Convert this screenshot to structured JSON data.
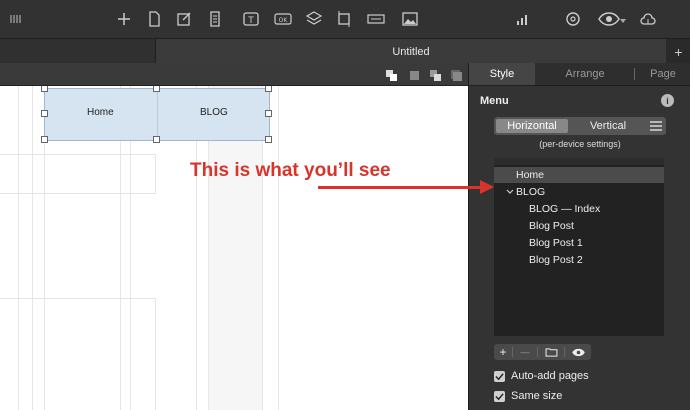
{
  "window": {
    "tab_title": "Untitled",
    "new_tab_label": "+"
  },
  "toolbar": {
    "icons": [
      "grip-icon",
      "plus-icon",
      "page-icon",
      "edit-icon",
      "list-doc-icon",
      "text-box-icon",
      "ok-button-icon",
      "layers-icon",
      "frame-icon",
      "resize-icon",
      "image-icon",
      "signal-icon",
      "settings-icon",
      "eye-icon",
      "cloud-upload-icon"
    ]
  },
  "canvas": {
    "menu": {
      "items": [
        {
          "label": "Home"
        },
        {
          "label": "BLOG"
        }
      ]
    }
  },
  "annotation": {
    "text": "This is what you’ll see",
    "color": "#d9342b"
  },
  "panel": {
    "tabs": [
      {
        "label": "Style"
      },
      {
        "label": "Arrange"
      },
      {
        "label": "Page"
      }
    ],
    "section_title": "Menu",
    "info_label": "i",
    "orientation": {
      "options": [
        "Horizontal",
        "Vertical"
      ],
      "selected": "Horizontal"
    },
    "device_note": "(per-device settings)",
    "tree": [
      {
        "label": "Home"
      },
      {
        "label": "BLOG"
      },
      {
        "label": "BLOG — Index"
      },
      {
        "label": "Blog Post"
      },
      {
        "label": "Blog Post 1"
      },
      {
        "label": "Blog Post 2"
      }
    ],
    "tree_buttons": {
      "add": "+",
      "remove": "—"
    },
    "checkboxes": [
      {
        "label": "Auto-add pages",
        "checked": true
      },
      {
        "label": "Same size",
        "checked": true
      }
    ]
  }
}
